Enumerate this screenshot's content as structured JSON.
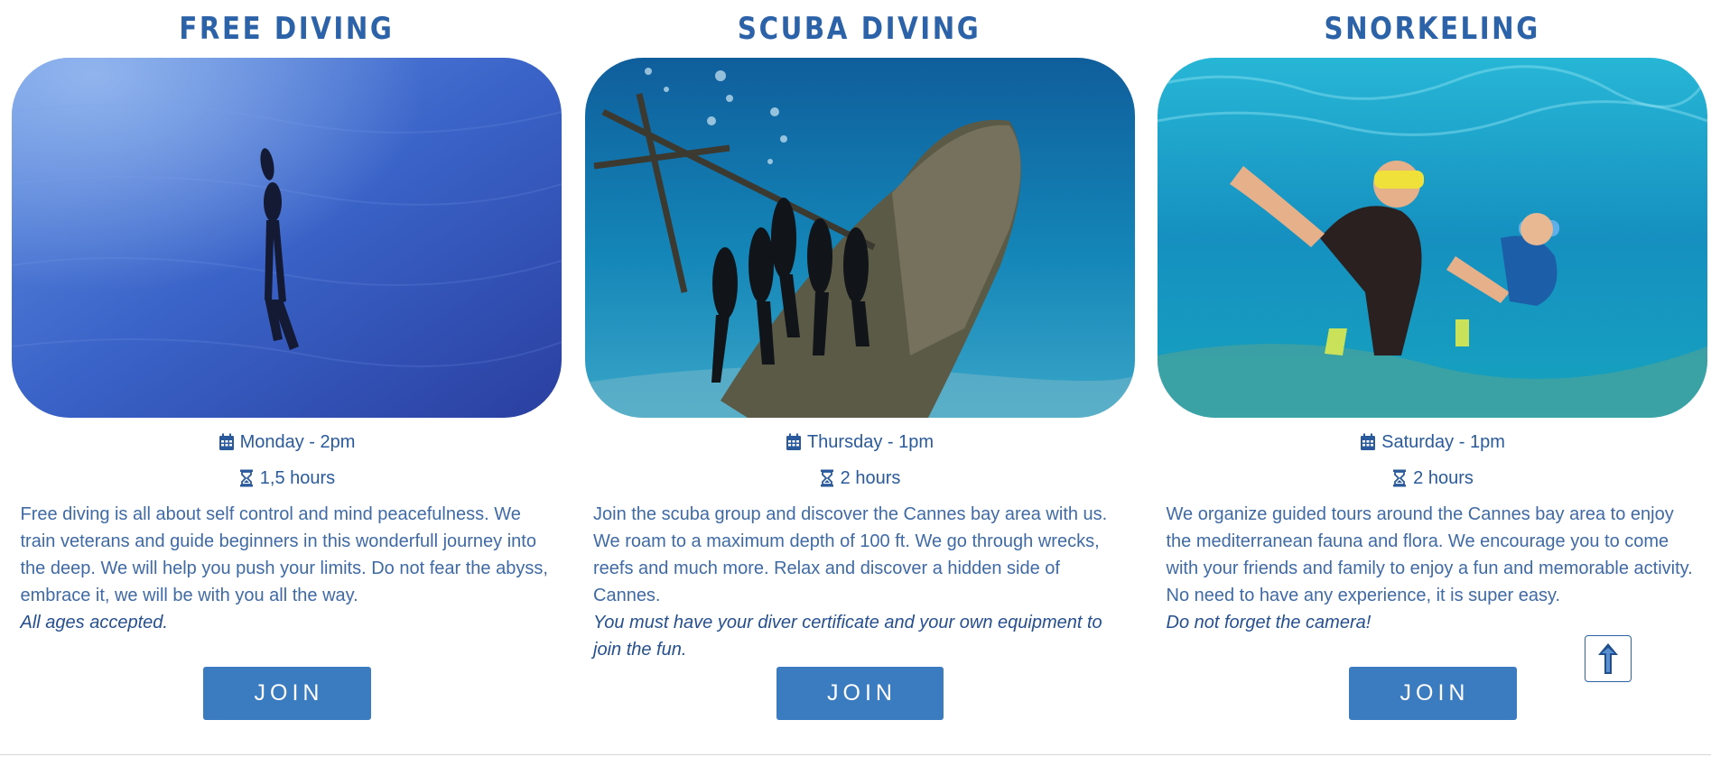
{
  "colors": {
    "title": "#2b62a8",
    "text": "#3f6aa5",
    "button": "#3b7bbf",
    "button_text": "#ffffff"
  },
  "cards": [
    {
      "title": "FREE DIVING",
      "image": "freediver-descending-in-blue-water",
      "schedule_icon": "calendar-icon",
      "schedule": "Monday - 2pm",
      "duration_icon": "hourglass-icon",
      "duration": "1,5 hours",
      "description": "Free diving is all about self control and mind peacefulness. We train veterans and guide beginners in this wonderfull journey into the deep. We will help you push your limits. Do not fear the abyss, embrace it, we will be with you all the way.",
      "note": "All ages accepted.",
      "button_label": "JOIN"
    },
    {
      "title": "SCUBA DIVING",
      "image": "scuba-divers-at-shipwreck",
      "schedule_icon": "calendar-icon",
      "schedule": "Thursday - 1pm",
      "duration_icon": "hourglass-icon",
      "duration": "2 hours",
      "description": "Join the scuba group and discover the Cannes bay area with us. We roam to a maximum depth of 100 ft. We go through wrecks, reefs and much more. Relax and discover a hidden side of Cannes.",
      "note": "You must have your diver certificate and your own equipment to join the fun.",
      "button_label": "JOIN"
    },
    {
      "title": "SNORKELING",
      "image": "mother-and-child-snorkeling",
      "schedule_icon": "calendar-icon",
      "schedule": "Saturday - 1pm",
      "duration_icon": "hourglass-icon",
      "duration": "2 hours",
      "description": "We organize guided tours around the Cannes bay area to enjoy the mediterranean fauna and flora. We encourage you to come with your friends and family to enjoy a fun and memorable activity. No need to have any experience, it is super easy.",
      "note": "Do not forget the camera!",
      "button_label": "JOIN"
    }
  ],
  "scroll_top": {
    "icon": "arrow-up-icon"
  }
}
